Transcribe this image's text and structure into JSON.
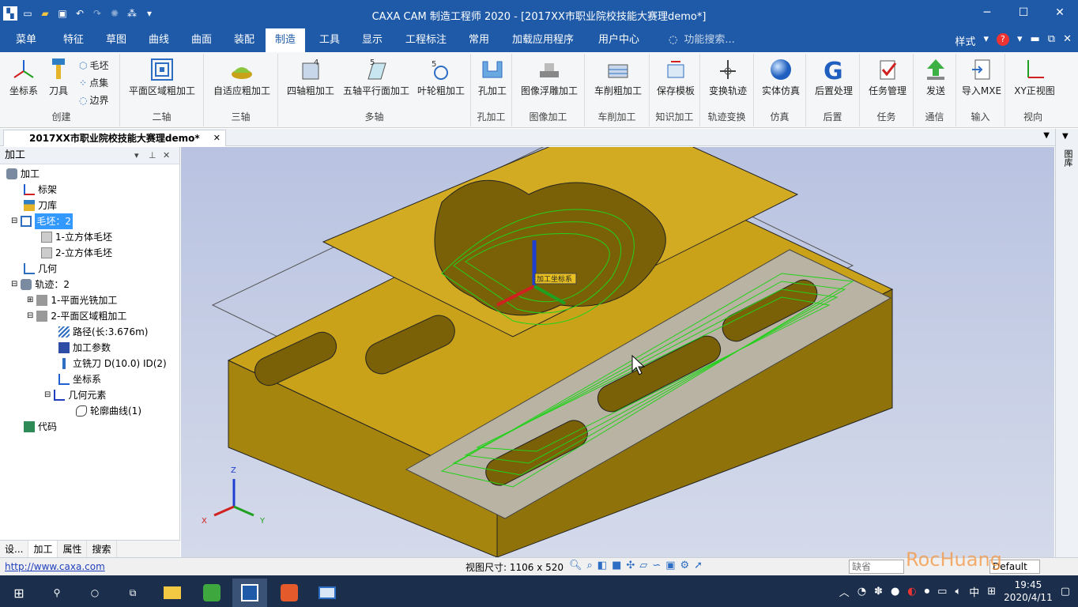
{
  "titlebar": {
    "title": "CAXA CAM 制造工程师 2020 - [2017XX市职业院校技能大赛理demo*]",
    "min": "─",
    "max": "☐",
    "close": "✕"
  },
  "menubar": {
    "items": [
      "菜单",
      "特征",
      "草图",
      "曲线",
      "曲面",
      "装配",
      "制造",
      "工具",
      "显示",
      "工程标注",
      "常用",
      "加载应用程序",
      "用户中心"
    ],
    "search_placeholder": "功能搜索...",
    "style_label": "样式",
    "help_icon": "?"
  },
  "ribbon": {
    "groups": [
      {
        "label": "创建",
        "buttons": [
          "坐标系",
          "刀具"
        ],
        "small": [
          "毛坯",
          "点集",
          "边界"
        ]
      },
      {
        "label": "二轴",
        "buttons": [
          "平面区域粗加工"
        ]
      },
      {
        "label": "三轴",
        "buttons": [
          "自适应粗加工"
        ]
      },
      {
        "label": "多轴",
        "buttons": [
          "四轴粗加工",
          "五轴平行面加工",
          "叶轮粗加工"
        ]
      },
      {
        "label": "孔加工",
        "buttons": [
          "孔加工"
        ]
      },
      {
        "label": "图像加工",
        "buttons": [
          "图像浮雕加工"
        ]
      },
      {
        "label": "车削加工",
        "buttons": [
          "车削粗加工"
        ]
      },
      {
        "label": "知识加工",
        "buttons": [
          "保存模板"
        ]
      },
      {
        "label": "轨迹变换",
        "buttons": [
          "变换轨迹"
        ]
      },
      {
        "label": "仿真",
        "buttons": [
          "实体仿真"
        ]
      },
      {
        "label": "后置",
        "buttons": [
          "后置处理"
        ]
      },
      {
        "label": "任务",
        "buttons": [
          "任务管理"
        ]
      },
      {
        "label": "通信",
        "buttons": [
          "发送"
        ]
      },
      {
        "label": "输入",
        "buttons": [
          "导入MXE"
        ]
      },
      {
        "label": "视向",
        "buttons": [
          "XY正视图"
        ]
      }
    ]
  },
  "doc_tab": {
    "label": "2017XX市职业院校技能大赛理demo*",
    "close": "✕"
  },
  "panel": {
    "title": "加工",
    "tree": [
      {
        "label": "加工",
        "level": 0
      },
      {
        "label": "标架",
        "level": 1
      },
      {
        "label": "刀库",
        "level": 1
      },
      {
        "label": "毛坯：2",
        "level": 1,
        "selected": true
      },
      {
        "label": "1-立方体毛坯",
        "level": 2
      },
      {
        "label": "2-立方体毛坯",
        "level": 2
      },
      {
        "label": "几何",
        "level": 1
      },
      {
        "label": "轨迹：2",
        "level": 1
      },
      {
        "label": "1-平面光铣加工",
        "level": 2
      },
      {
        "label": "2-平面区域粗加工",
        "level": 2
      },
      {
        "label": "路径(长:3.676m)",
        "level": 3
      },
      {
        "label": "加工参数",
        "level": 3
      },
      {
        "label": "立铣刀 D(10.0) ID(2)",
        "level": 3
      },
      {
        "label": "坐标系",
        "level": 3
      },
      {
        "label": "几何元素",
        "level": 3
      },
      {
        "label": "轮廓曲线(1)",
        "level": 4
      },
      {
        "label": "代码",
        "level": 1
      }
    ],
    "tabs": [
      "设...",
      "加工",
      "属性",
      "搜索"
    ]
  },
  "viewport": {
    "csys_label": "加工坐标系",
    "axis_x": "X",
    "axis_y": "Y",
    "axis_z": "Z"
  },
  "right_strip": {
    "label": "图库"
  },
  "status": {
    "url": "http://www.caxa.com",
    "view_size": "视图尺寸: 1106 x  520",
    "default_input": "缺省",
    "default_label": "Default",
    "watermark": "RocHuang"
  },
  "taskbar": {
    "time": "19:45",
    "date": "2020/4/11",
    "ime": "中"
  },
  "colors": {
    "brand": "#1e5aa8",
    "model": "#c9a21a",
    "toolpath": "#22d11a"
  }
}
